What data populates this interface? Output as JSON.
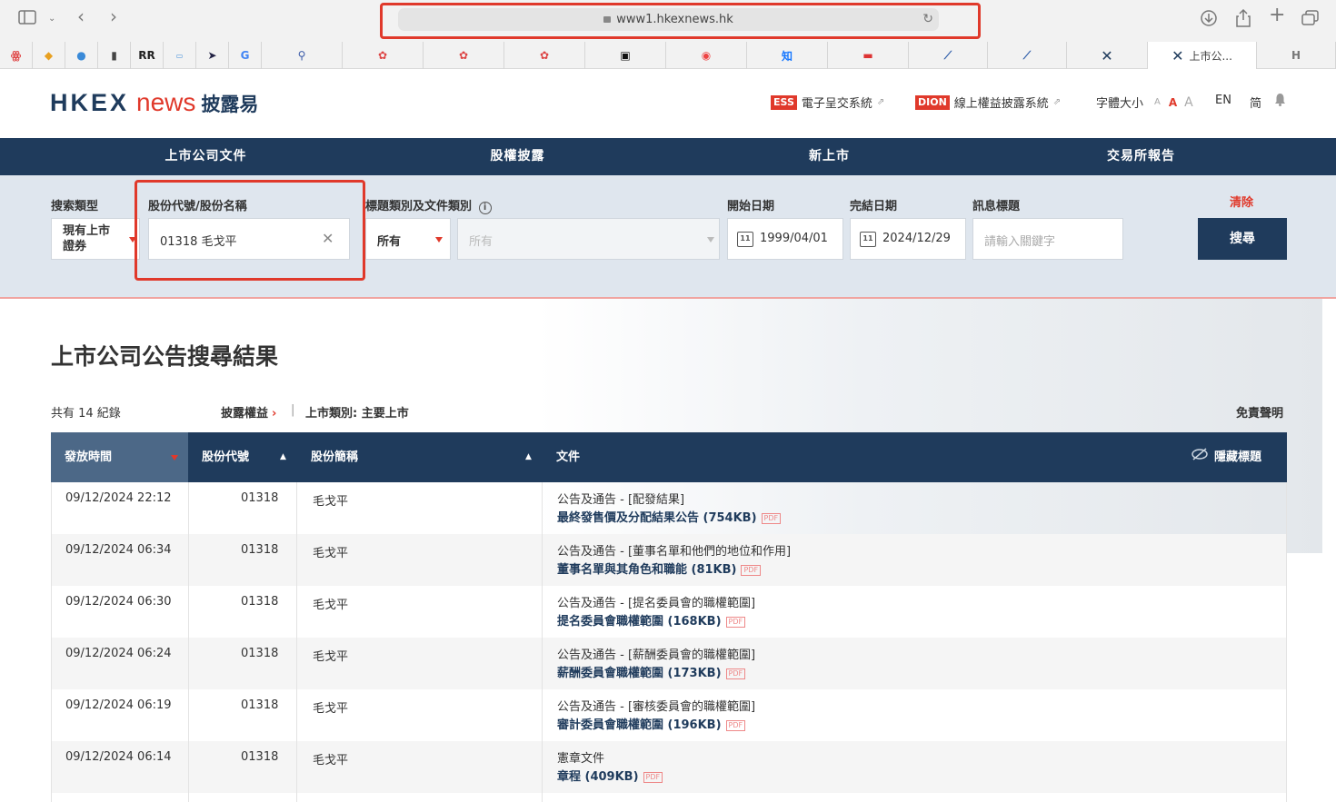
{
  "browser": {
    "url": "www1.hkexnews.hk",
    "active_tab_label": "上市公..."
  },
  "header": {
    "logo_hkex": "HKEX",
    "logo_news": "news",
    "logo_cn": "披露易",
    "ess_badge": "ESS",
    "ess_label": "電子呈交系統",
    "dion_badge": "DION",
    "dion_label": "線上權益披露系統",
    "font_size_label": "字體大小",
    "font_a": "A",
    "lang_en": "EN",
    "lang_sc": "简"
  },
  "nav": {
    "items": [
      "上市公司文件",
      "股權披露",
      "新上市",
      "交易所報告"
    ]
  },
  "search": {
    "type_label": "搜索類型",
    "type_value": "現有上市證券",
    "stock_label": "股份代號/股份名稱",
    "stock_value": "01318 毛戈平",
    "category_label": "標題類別及文件類別",
    "category_value": "所有",
    "subcategory_placeholder": "所有",
    "start_label": "開始日期",
    "start_value": "1999/04/01",
    "end_label": "完結日期",
    "end_value": "2024/12/29",
    "headline_label": "訊息標題",
    "headline_placeholder": "請輸入關鍵字",
    "clear_label": "清除",
    "search_button": "搜尋"
  },
  "results": {
    "title": "上市公司公告搜尋結果",
    "count_text": "共有 14 紀錄",
    "disclosure_link": "披露權益",
    "listing_type": "上市類別: 主要上市",
    "disclaimer": "免責聲明",
    "columns": {
      "time": "發放時間",
      "code": "股份代號",
      "name": "股份簡稱",
      "doc": "文件",
      "hide": "隱藏標題"
    },
    "rows": [
      {
        "time": "09/12/2024 22:12",
        "code": "01318",
        "name": "毛戈平",
        "headline": "公告及通告 - [配發結果]",
        "doc": "最終發售價及分配結果公告 (754KB)"
      },
      {
        "time": "09/12/2024 06:34",
        "code": "01318",
        "name": "毛戈平",
        "headline": "公告及通告 - [董事名單和他們的地位和作用]",
        "doc": "董事名單與其角色和職能 (81KB)"
      },
      {
        "time": "09/12/2024 06:30",
        "code": "01318",
        "name": "毛戈平",
        "headline": "公告及通告 - [提名委員會的職權範圍]",
        "doc": "提名委員會職權範圍 (168KB)"
      },
      {
        "time": "09/12/2024 06:24",
        "code": "01318",
        "name": "毛戈平",
        "headline": "公告及通告 - [薪酬委員會的職權範圍]",
        "doc": "薪酬委員會職權範圍 (173KB)"
      },
      {
        "time": "09/12/2024 06:19",
        "code": "01318",
        "name": "毛戈平",
        "headline": "公告及通告 - [審核委員會的職權範圍]",
        "doc": "審計委員會職權範圍 (196KB)"
      },
      {
        "time": "09/12/2024 06:14",
        "code": "01318",
        "name": "毛戈平",
        "headline": "憲章文件",
        "doc": "章程 (409KB)"
      }
    ],
    "pdf_tag": "PDF"
  },
  "colors": {
    "navy": "#1f3b5c",
    "accent_red": "#e0392b",
    "panel": "#dfe6ee"
  }
}
